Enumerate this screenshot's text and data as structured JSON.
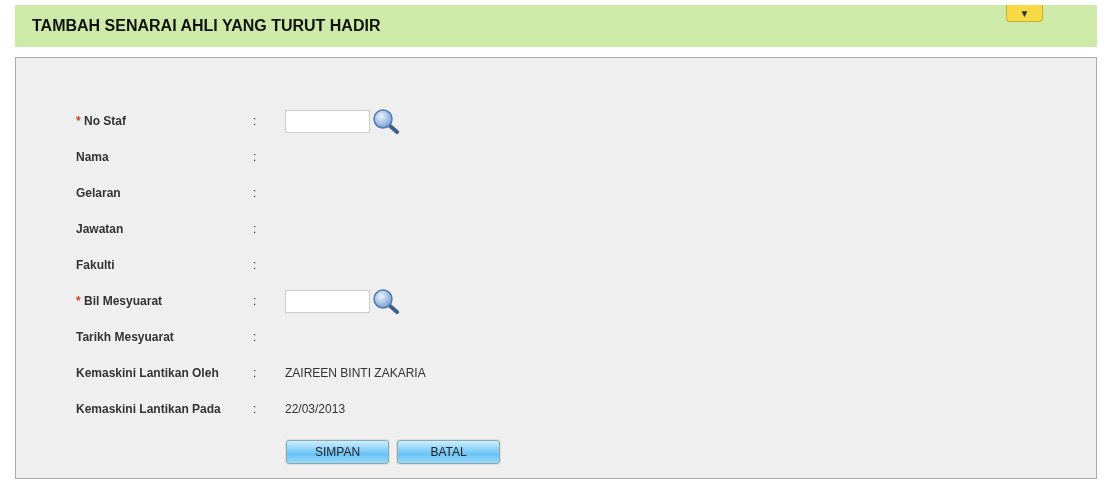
{
  "header": {
    "title": "TAMBAH SENARAI AHLI YANG TURUT HADIR",
    "toggle": "▼"
  },
  "fields": [
    {
      "kind": "input",
      "label": "No Staf",
      "required_mark": "*",
      "separator": ":"
    },
    {
      "kind": "text",
      "label": "Nama",
      "separator": ":"
    },
    {
      "kind": "text",
      "label": "Gelaran",
      "separator": ":"
    },
    {
      "kind": "text",
      "label": "Jawatan",
      "separator": ":"
    },
    {
      "kind": "text",
      "label": "Fakulti",
      "separator": ":"
    },
    {
      "kind": "input",
      "label": "Bil Mesyuarat",
      "required_mark": "*",
      "separator": ":"
    },
    {
      "kind": "text",
      "label": "Tarikh Mesyuarat",
      "separator": ":"
    },
    {
      "kind": "text",
      "label": "Kemaskini Lantikan Oleh",
      "separator": ":",
      "value": "ZAIREEN BINTI ZAKARIA"
    },
    {
      "kind": "text",
      "label": "Kemaskini Lantikan Pada",
      "separator": ":",
      "value": "22/03/2013"
    }
  ],
  "buttons": [
    "SIMPAN",
    "BATAL"
  ]
}
